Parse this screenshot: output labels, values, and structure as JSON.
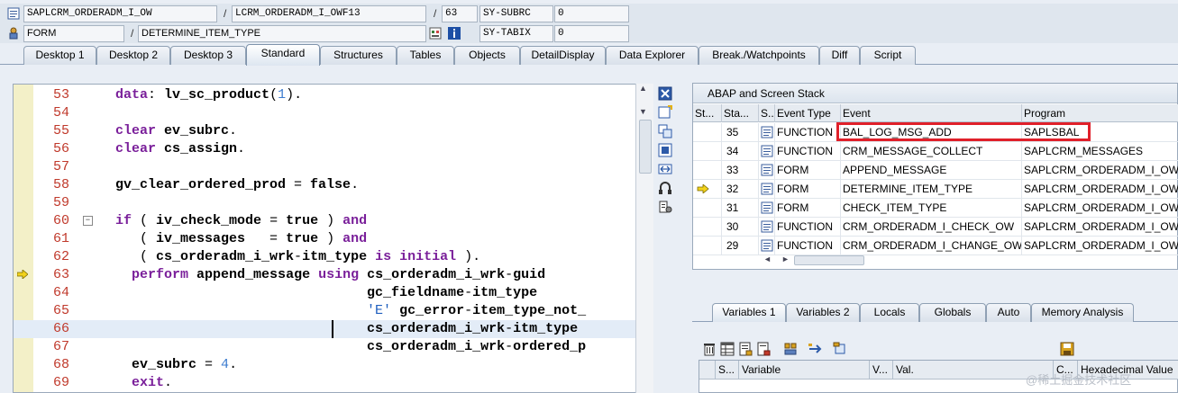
{
  "row1": {
    "program": "SAPLCRM_ORDERADM_I_OW",
    "include": "LCRM_ORDERADM_I_OWF13",
    "line": "63",
    "sysfield": "SY-SUBRC",
    "sysvalue": "0"
  },
  "row2": {
    "event_type": "FORM",
    "event": "DETERMINE_ITEM_TYPE",
    "sysfield": "SY-TABIX",
    "sysvalue": "0"
  },
  "separator": "/",
  "tabs": [
    {
      "label": "Desktop 1"
    },
    {
      "label": "Desktop 2"
    },
    {
      "label": "Desktop 3"
    },
    {
      "label": "Standard"
    },
    {
      "label": "Structures"
    },
    {
      "label": "Tables"
    },
    {
      "label": "Objects"
    },
    {
      "label": "DetailDisplay"
    },
    {
      "label": "Data Explorer"
    },
    {
      "label": "Break./Watchpoints"
    },
    {
      "label": "Diff"
    },
    {
      "label": "Script"
    }
  ],
  "active_tab": "Standard",
  "code": {
    "lines": [
      {
        "no": "53",
        "parts": [
          [
            "kw",
            "data"
          ],
          [
            "p",
            ": "
          ],
          [
            "ident",
            "lv_sc_product"
          ],
          [
            "p",
            "("
          ],
          [
            "num",
            "1"
          ],
          [
            "p",
            ")."
          ]
        ]
      },
      {
        "no": "54",
        "parts": []
      },
      {
        "no": "55",
        "parts": [
          [
            "kw",
            "clear"
          ],
          [
            "p",
            " "
          ],
          [
            "ident",
            "ev_subrc"
          ],
          [
            "p",
            "."
          ]
        ]
      },
      {
        "no": "56",
        "parts": [
          [
            "kw",
            "clear"
          ],
          [
            "p",
            " "
          ],
          [
            "ident",
            "cs_assign"
          ],
          [
            "p",
            "."
          ]
        ]
      },
      {
        "no": "57",
        "parts": []
      },
      {
        "no": "58",
        "parts": [
          [
            "ident",
            "gv_clear_ordered_prod"
          ],
          [
            "p",
            " = "
          ],
          [
            "ident",
            "false"
          ],
          [
            "p",
            "."
          ]
        ]
      },
      {
        "no": "59",
        "parts": []
      },
      {
        "no": "60",
        "parts": [
          [
            "kw",
            "if"
          ],
          [
            "p",
            " ( "
          ],
          [
            "ident",
            "iv_check_mode"
          ],
          [
            "p",
            " = "
          ],
          [
            "ident",
            "true"
          ],
          [
            "p",
            " ) "
          ],
          [
            "kw",
            "and"
          ]
        ]
      },
      {
        "no": "61",
        "parts": [
          [
            "p",
            "   ( "
          ],
          [
            "ident",
            "iv_messages"
          ],
          [
            "p",
            "   = "
          ],
          [
            "ident",
            "true"
          ],
          [
            "p",
            " ) "
          ],
          [
            "kw",
            "and"
          ]
        ]
      },
      {
        "no": "62",
        "parts": [
          [
            "p",
            "   ( "
          ],
          [
            "ident",
            "cs_orderadm_i_wrk"
          ],
          [
            "p",
            "-"
          ],
          [
            "ident",
            "itm_type"
          ],
          [
            "p",
            " "
          ],
          [
            "kw",
            "is initial"
          ],
          [
            "p",
            " )."
          ]
        ]
      },
      {
        "no": "63",
        "parts": [
          [
            "p",
            "  "
          ],
          [
            "kw",
            "perform"
          ],
          [
            "p",
            " "
          ],
          [
            "ident",
            "append_message"
          ],
          [
            "p",
            " "
          ],
          [
            "kw",
            "using"
          ],
          [
            "p",
            " "
          ],
          [
            "ident",
            "cs_orderadm_i_wrk"
          ],
          [
            "p",
            "-"
          ],
          [
            "ident",
            "guid"
          ]
        ]
      },
      {
        "no": "64",
        "parts": [
          [
            "p",
            "                               "
          ],
          [
            "ident",
            "gc_fieldname"
          ],
          [
            "p",
            "-"
          ],
          [
            "ident",
            "itm_type"
          ]
        ]
      },
      {
        "no": "65",
        "parts": [
          [
            "p",
            "                               "
          ],
          [
            "str",
            "'E'"
          ],
          [
            "p",
            " "
          ],
          [
            "ident",
            "gc_error"
          ],
          [
            "p",
            "-"
          ],
          [
            "ident",
            "item_type_not_"
          ]
        ]
      },
      {
        "no": "66",
        "parts": [
          [
            "p",
            "                               "
          ],
          [
            "ident",
            "cs_orderadm_i_wrk"
          ],
          [
            "p",
            "-"
          ],
          [
            "ident",
            "itm_type"
          ]
        ]
      },
      {
        "no": "67",
        "parts": [
          [
            "p",
            "                               "
          ],
          [
            "ident",
            "cs_orderadm_i_wrk"
          ],
          [
            "p",
            "-"
          ],
          [
            "ident",
            "ordered_p"
          ]
        ]
      },
      {
        "no": "68",
        "parts": [
          [
            "p",
            "  "
          ],
          [
            "ident",
            "ev_subrc"
          ],
          [
            "p",
            " = "
          ],
          [
            "num",
            "4"
          ],
          [
            "p",
            "."
          ]
        ]
      },
      {
        "no": "69",
        "parts": [
          [
            "p",
            "  "
          ],
          [
            "kw",
            "exit"
          ],
          [
            "p",
            "."
          ]
        ]
      }
    ]
  },
  "stack": {
    "title": "ABAP and Screen Stack",
    "headers": [
      "St...",
      "Sta...",
      "S...",
      "Event Type",
      "Event",
      "Program"
    ],
    "rows": [
      {
        "level": "35",
        "type": "FUNCTION",
        "event": "BAL_LOG_MSG_ADD",
        "program": "SAPLSBAL",
        "current": false
      },
      {
        "level": "34",
        "type": "FUNCTION",
        "event": "CRM_MESSAGE_COLLECT",
        "program": "SAPLCRM_MESSAGES",
        "current": false
      },
      {
        "level": "33",
        "type": "FORM",
        "event": "APPEND_MESSAGE",
        "program": "SAPLCRM_ORDERADM_I_OW",
        "current": false
      },
      {
        "level": "32",
        "type": "FORM",
        "event": "DETERMINE_ITEM_TYPE",
        "program": "SAPLCRM_ORDERADM_I_OW",
        "current": true
      },
      {
        "level": "31",
        "type": "FORM",
        "event": "CHECK_ITEM_TYPE",
        "program": "SAPLCRM_ORDERADM_I_OW",
        "current": false
      },
      {
        "level": "30",
        "type": "FUNCTION",
        "event": "CRM_ORDERADM_I_CHECK_OW",
        "program": "SAPLCRM_ORDERADM_I_OW",
        "current": false
      },
      {
        "level": "29",
        "type": "FUNCTION",
        "event": "CRM_ORDERADM_I_CHANGE_OW",
        "program": "SAPLCRM_ORDERADM_I_OW",
        "current": false
      }
    ]
  },
  "var_tabs": [
    {
      "label": "Variables 1"
    },
    {
      "label": "Variables 2"
    },
    {
      "label": "Locals"
    },
    {
      "label": "Globals"
    },
    {
      "label": "Auto"
    },
    {
      "label": "Memory Analysis"
    }
  ],
  "var_headers": [
    "S...",
    "Variable",
    "V...",
    "Val.",
    "C...",
    "Hexadecimal Value"
  ],
  "watermark": "@稀土掘金技术社区",
  "colors": {
    "highlight_box": "#e0202a",
    "keyword": "#7a1f9a",
    "line_number": "#c0392b",
    "current_arrow": "#f2d21b"
  }
}
